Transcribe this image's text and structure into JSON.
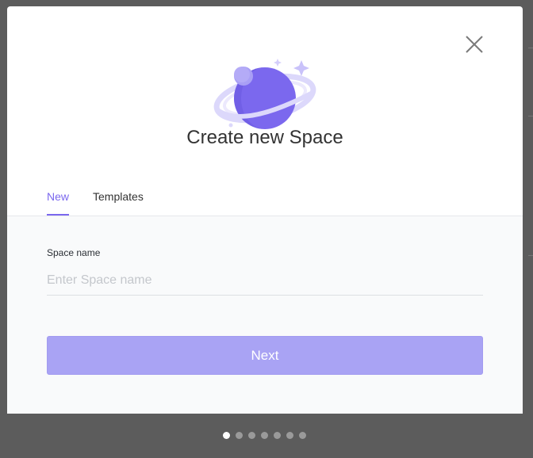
{
  "dialog": {
    "title": "Create new Space",
    "close_icon": "close-icon",
    "illustration_icon": "planet-icon"
  },
  "tabs": [
    {
      "label": "New",
      "active": true
    },
    {
      "label": "Templates",
      "active": false
    }
  ],
  "form": {
    "space_name_label": "Space name",
    "space_name_value": "",
    "space_name_placeholder": "Enter Space name",
    "next_label": "Next"
  },
  "pager": {
    "total": 7,
    "current": 1
  },
  "colors": {
    "accent": "#7b68ee",
    "next_button": "#a9a3f4",
    "backdrop": "#5c5c5c"
  }
}
